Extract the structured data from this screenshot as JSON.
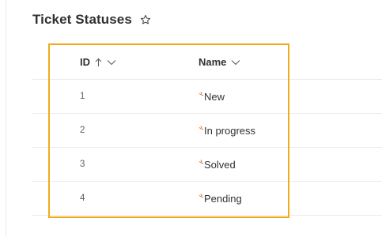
{
  "page": {
    "title": "Ticket Statuses",
    "favorite_icon": "star-icon"
  },
  "table": {
    "columns": [
      {
        "label": "ID",
        "sort": "ascending"
      },
      {
        "label": "Name",
        "sort": "none"
      }
    ],
    "rows": [
      {
        "id": "1",
        "name": "New"
      },
      {
        "id": "2",
        "name": "In progress"
      },
      {
        "id": "3",
        "name": "Solved"
      },
      {
        "id": "4",
        "name": "Pending"
      }
    ],
    "new_item_indicator_icon": "sparkle-icon"
  },
  "colors": {
    "highlight": "#f0ab1c",
    "new_indicator": "#d86b1f",
    "divider": "#edebe9"
  }
}
